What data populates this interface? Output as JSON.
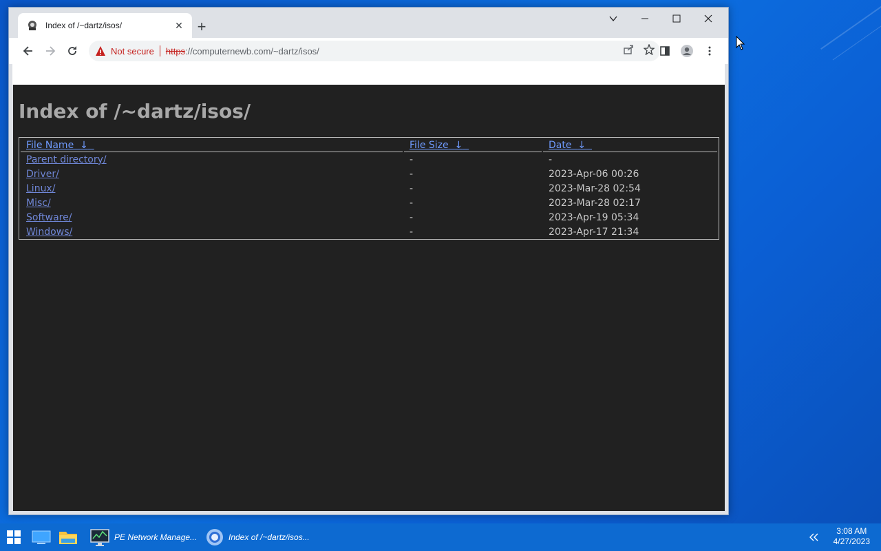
{
  "browser": {
    "tab": {
      "title": "Index of /~dartz/isos/"
    },
    "address": {
      "security_label": "Not secure",
      "scheme": "https",
      "rest": "://computernewb.com/~dartz/isos/"
    }
  },
  "page": {
    "title": "Index of /~dartz/isos/",
    "columns": {
      "name": "File Name",
      "size": "File Size",
      "date": "Date",
      "sort_glyph": "↓"
    },
    "rows": [
      {
        "name": "Parent directory/",
        "size": "-",
        "date": "-"
      },
      {
        "name": "Driver/",
        "size": "-",
        "date": "2023-Apr-06 00:26"
      },
      {
        "name": "Linux/",
        "size": "-",
        "date": "2023-Mar-28 02:54"
      },
      {
        "name": "Misc/",
        "size": "-",
        "date": "2023-Mar-28 02:17"
      },
      {
        "name": "Software/",
        "size": "-",
        "date": "2023-Apr-19 05:34"
      },
      {
        "name": "Windows/",
        "size": "-",
        "date": "2023-Apr-17 21:34"
      }
    ]
  },
  "taskbar": {
    "items": [
      {
        "label": "PE Network Manage..."
      },
      {
        "label": "Index of /~dartz/isos..."
      }
    ],
    "time": "3:08 AM",
    "date": "4/27/2023"
  }
}
